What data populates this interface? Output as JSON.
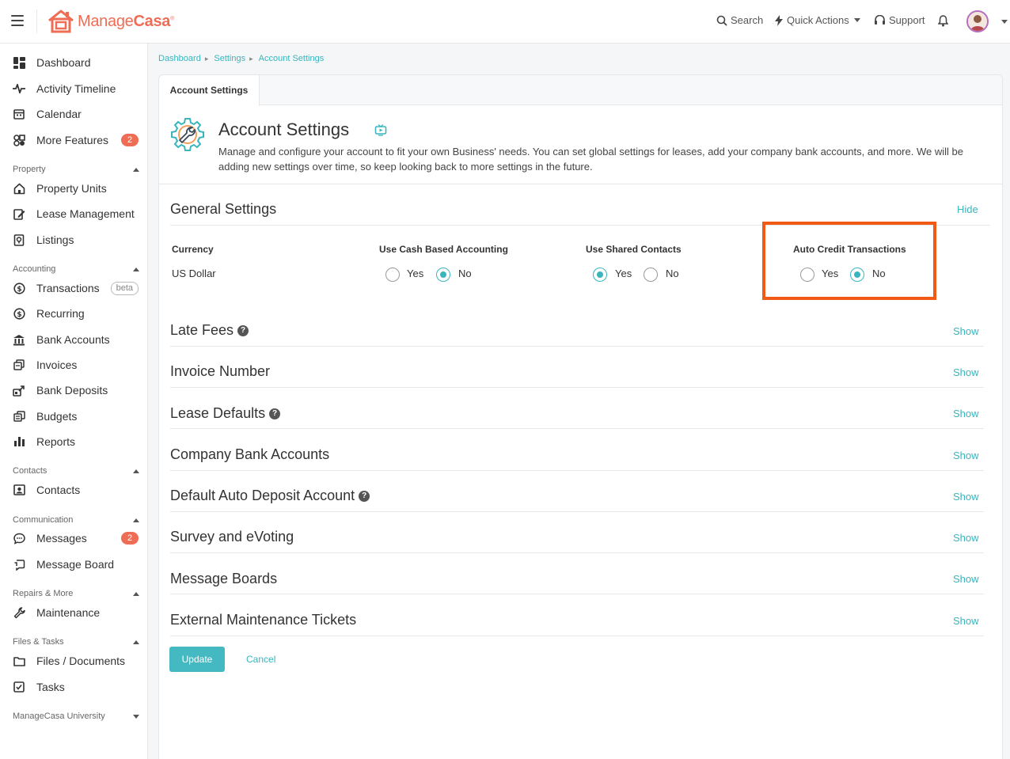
{
  "brand": {
    "name_light": "Manage",
    "name_bold": "Casa",
    "mark": "®",
    "accent": "#ef6c55",
    "teal": "#3ab5bd"
  },
  "topbar": {
    "search": "Search",
    "quick_actions": "Quick Actions",
    "support": "Support"
  },
  "sidebar": {
    "dashboard": "Dashboard",
    "activity_timeline": "Activity Timeline",
    "calendar": "Calendar",
    "more_features": "More Features",
    "more_features_badge": "2",
    "section_property": "Property",
    "property_units": "Property Units",
    "lease_management": "Lease Management",
    "listings": "Listings",
    "section_accounting": "Accounting",
    "transactions": "Transactions",
    "transactions_badge": "beta",
    "recurring": "Recurring",
    "bank_accounts": "Bank Accounts",
    "invoices": "Invoices",
    "bank_deposits": "Bank Deposits",
    "budgets": "Budgets",
    "reports": "Reports",
    "section_contacts": "Contacts",
    "contacts": "Contacts",
    "section_communication": "Communication",
    "messages": "Messages",
    "messages_badge": "2",
    "message_board": "Message Board",
    "section_repairs": "Repairs & More",
    "maintenance": "Maintenance",
    "section_files": "Files & Tasks",
    "files_documents": "Files / Documents",
    "tasks": "Tasks",
    "section_university": "ManageCasa University"
  },
  "breadcrumb": [
    "Dashboard",
    "Settings",
    "Account Settings"
  ],
  "tab": "Account Settings",
  "page": {
    "title": "Account Settings",
    "description": "Manage and configure your account to fit your own Business' needs. You can set global settings for leases, add your company bank accounts, and more. We will be adding new settings over time, so keep looking back to more settings in the future."
  },
  "general_settings": {
    "title": "General Settings",
    "toggle": "Hide",
    "currency_label": "Currency",
    "currency_value": "US Dollar",
    "cash_label": "Use Cash Based Accounting",
    "cash_value": "No",
    "shared_label": "Use Shared Contacts",
    "shared_value": "Yes",
    "auto_credit_label": "Auto Credit Transactions",
    "auto_credit_value": "No",
    "yes": "Yes",
    "no": "No"
  },
  "sections": [
    {
      "title": "Late Fees",
      "help": true,
      "toggle": "Show"
    },
    {
      "title": "Invoice Number",
      "help": false,
      "toggle": "Show"
    },
    {
      "title": "Lease Defaults",
      "help": true,
      "toggle": "Show"
    },
    {
      "title": "Company Bank Accounts",
      "help": false,
      "toggle": "Show"
    },
    {
      "title": "Default Auto Deposit Account",
      "help": true,
      "toggle": "Show"
    },
    {
      "title": "Survey and eVoting",
      "help": false,
      "toggle": "Show"
    },
    {
      "title": "Message Boards",
      "help": false,
      "toggle": "Show"
    },
    {
      "title": "External Maintenance Tickets",
      "help": false,
      "toggle": "Show"
    }
  ],
  "actions": {
    "update": "Update",
    "cancel": "Cancel"
  }
}
